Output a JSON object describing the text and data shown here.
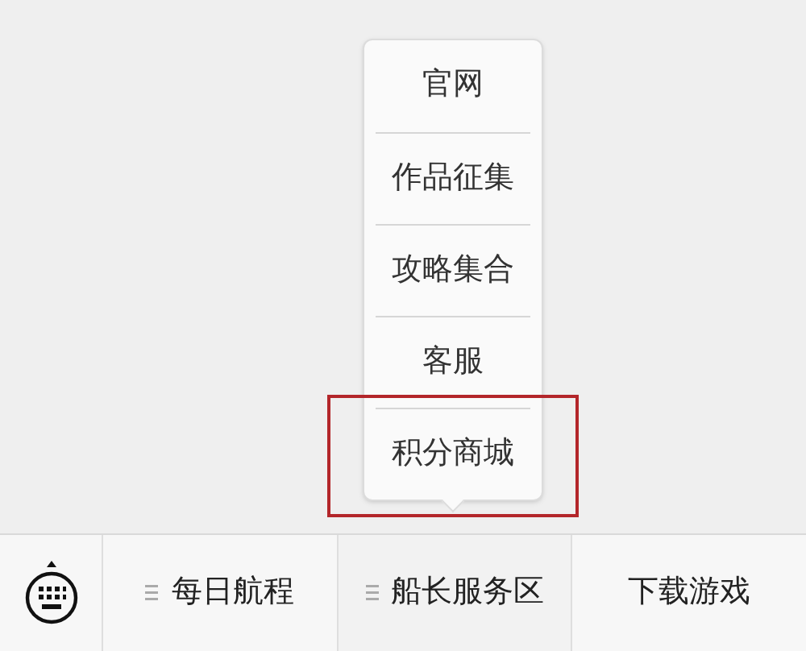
{
  "menu_bar": {
    "items": [
      {
        "label": "每日航程",
        "has_submenu": true,
        "expanded": false
      },
      {
        "label": "船长服务区",
        "has_submenu": true,
        "expanded": true,
        "submenu": [
          {
            "label": "官网",
            "highlighted": false
          },
          {
            "label": "作品征集",
            "highlighted": false
          },
          {
            "label": "攻略集合",
            "highlighted": false
          },
          {
            "label": "客服",
            "highlighted": false
          },
          {
            "label": "积分商城",
            "highlighted": true
          }
        ]
      },
      {
        "label": "下载游戏",
        "has_submenu": false,
        "expanded": false
      }
    ]
  }
}
